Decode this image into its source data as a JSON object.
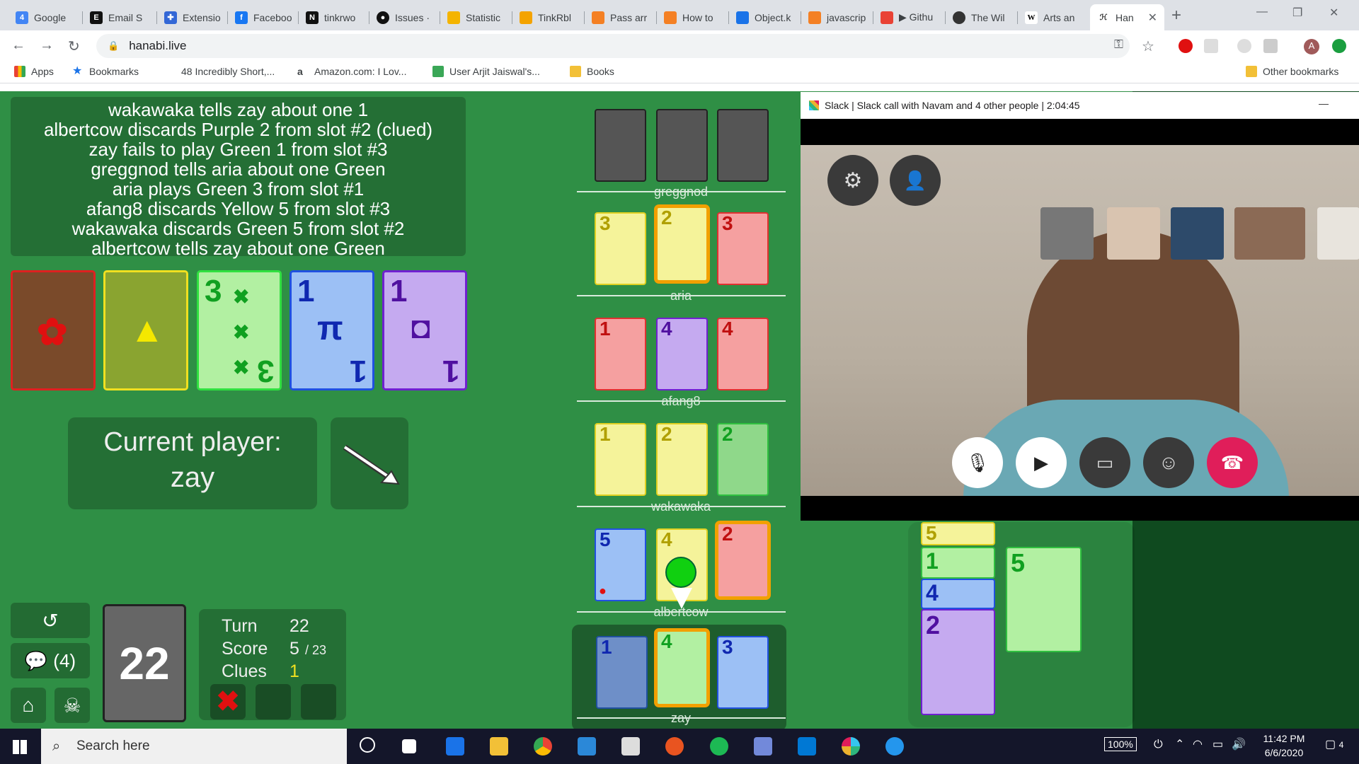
{
  "browser": {
    "tabs": [
      {
        "label": "Google",
        "fav": "G",
        "color": "#4285f4"
      },
      {
        "label": "Email S",
        "fav": "E",
        "color": "#111"
      },
      {
        "label": "Extensio",
        "fav": "",
        "color": "#3367d6"
      },
      {
        "label": "Faceboo",
        "fav": "f",
        "color": "#1877f2"
      },
      {
        "label": "tinkrwo",
        "fav": "N",
        "color": "#111"
      },
      {
        "label": "Issues ·",
        "fav": "",
        "color": "#111"
      },
      {
        "label": "Statistic",
        "fav": "",
        "color": "#f4b400"
      },
      {
        "label": "TinkRbl",
        "fav": "",
        "color": "#f4a300"
      },
      {
        "label": "Pass arr",
        "fav": "",
        "color": "#f48024"
      },
      {
        "label": "How to",
        "fav": "",
        "color": "#f48024"
      },
      {
        "label": "Object.k",
        "fav": "",
        "color": "#1a73e8"
      },
      {
        "label": "javascrip",
        "fav": "",
        "color": "#f48024"
      },
      {
        "label": "▶ Githu",
        "fav": "",
        "color": "#e94235"
      },
      {
        "label": "The Wil",
        "fav": "",
        "color": "#333"
      },
      {
        "label": "Arts an",
        "fav": "W",
        "color": "#fff"
      },
      {
        "label": "Han",
        "fav": "",
        "color": "#333"
      }
    ],
    "url": "hanabi.live",
    "bookmarks": {
      "apps": "Apps",
      "bookmarks": "Bookmarks",
      "b1": "48 Incredibly Short,...",
      "b2": "Amazon.com: I Lov...",
      "b3": "User Arjit Jaiswal's...",
      "b4": "Books",
      "other": "Other bookmarks"
    },
    "profile_letter": "A"
  },
  "game": {
    "log": [
      "wakawaka tells zay about one 1",
      "albertcow discards Purple 2 from slot #2 (clued)",
      "zay fails to play Green 1 from slot #3",
      "greggnod tells aria about one Green",
      "aria plays Green 3 from slot #1",
      "afang8 discards Yellow 5 from slot #3",
      "wakawaka discards Green 5 from slot #2",
      "albertcow tells zay about one Green"
    ],
    "play_stacks": [
      {
        "color": "red",
        "number": "",
        "symbol": "✿"
      },
      {
        "color": "yellow",
        "number": "",
        "symbol": "▲"
      },
      {
        "color": "green",
        "number": "3",
        "symbol": "✖"
      },
      {
        "color": "blue",
        "number": "1",
        "symbol": "π"
      },
      {
        "color": "purple",
        "number": "1",
        "symbol": "◘"
      }
    ],
    "current_player_label": "Current player:",
    "current_player": "zay",
    "chat_count": "(4)",
    "deck_count": "22",
    "stats": {
      "turn_label": "Turn",
      "turn": "22",
      "score_label": "Score",
      "score": "5",
      "score_max": "/ 23",
      "clues_label": "Clues",
      "clues": "1"
    },
    "strike_mark": "✖",
    "players": [
      {
        "name": "greggnod"
      },
      {
        "name": "aria"
      },
      {
        "name": "afang8"
      },
      {
        "name": "wakawaka"
      },
      {
        "name": "albertcow"
      },
      {
        "name": "zay"
      }
    ],
    "hands": {
      "aria": [
        {
          "n": "3",
          "c": "yellow"
        },
        {
          "n": "2",
          "c": "yellow",
          "clued": true
        },
        {
          "n": "3",
          "c": "red"
        }
      ],
      "afang8": [
        {
          "n": "1",
          "c": "red"
        },
        {
          "n": "4",
          "c": "purple"
        },
        {
          "n": "4",
          "c": "red"
        }
      ],
      "wakawaka": [
        {
          "n": "1",
          "c": "yellow"
        },
        {
          "n": "2",
          "c": "yellow"
        },
        {
          "n": "2",
          "c": "green"
        }
      ],
      "albertcow": [
        {
          "n": "5",
          "c": "blue"
        },
        {
          "n": "4",
          "c": "yellow"
        },
        {
          "n": "2",
          "c": "red",
          "clued": true
        }
      ],
      "zay": [
        {
          "n": "1",
          "c": "blue"
        },
        {
          "n": "4",
          "c": "green",
          "clued": true
        },
        {
          "n": "3",
          "c": "blue"
        }
      ]
    },
    "discard_stacks": [
      {
        "n": "5",
        "c": "yellow"
      },
      {
        "n": "1",
        "c": "green"
      },
      {
        "n": "4",
        "c": "blue"
      },
      {
        "n": "2",
        "c": "purple"
      },
      {
        "n": "5",
        "c": "green"
      }
    ]
  },
  "slack": {
    "title": "Slack | Slack call with Navam and 4 other people | 2:04:45"
  },
  "taskbar": {
    "search_placeholder": "Search here",
    "battery": "100%",
    "time": "11:42 PM",
    "date": "6/6/2020",
    "notifications": "4"
  }
}
